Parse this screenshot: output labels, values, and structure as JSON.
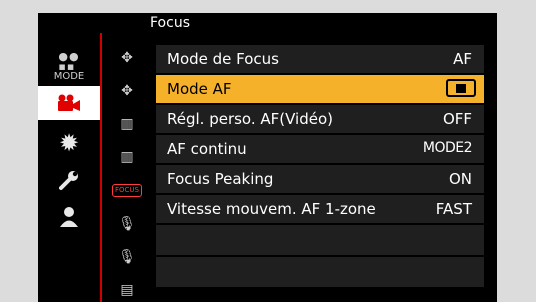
{
  "title": "Focus",
  "sidebar": [
    {
      "icon": "mode-dial-icon",
      "label": "MODE"
    },
    {
      "icon": "video-camera-icon",
      "selected": true
    },
    {
      "icon": "gear-icon"
    },
    {
      "icon": "wrench-icon"
    },
    {
      "icon": "person-icon"
    }
  ],
  "subtabs": [
    {
      "icon": "af-point-icon"
    },
    {
      "icon": "af-point-icon"
    },
    {
      "icon": "film-icon"
    },
    {
      "icon": "film-icon"
    },
    {
      "icon": "focus-icon",
      "label": "FOCUS",
      "active": true
    },
    {
      "icon": "microphone-icon"
    },
    {
      "icon": "microphone-icon"
    },
    {
      "icon": "film-dots-icon"
    }
  ],
  "menu": [
    {
      "label": "Mode de Focus",
      "value": "AF"
    },
    {
      "label": "Mode AF",
      "value": "",
      "icon": "af-area-icon",
      "highlighted": true
    },
    {
      "label": "Régl. perso. AF(Vidéo)",
      "value": "OFF"
    },
    {
      "label": "AF continu",
      "value": "MODE2"
    },
    {
      "label": "Focus Peaking",
      "value": "ON"
    },
    {
      "label": "Vitesse mouvem. AF 1-zone",
      "value": "FAST"
    }
  ],
  "colors": {
    "highlight": "#f6b12a",
    "accent_red": "#d00000",
    "background": "#000000"
  }
}
